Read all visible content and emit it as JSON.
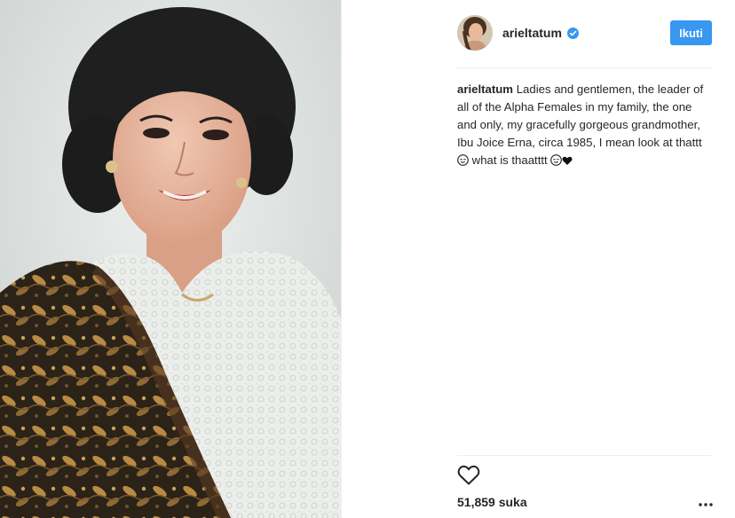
{
  "author": {
    "username": "arieltatum",
    "verified": true,
    "follow_label": "Ikuti"
  },
  "caption": {
    "username": "arieltatum",
    "text": "Ladies and gentlemen, the leader of all of the Alpha Females in my family, the one and only, my gracefully gorgeous grandmother, Ibu Joice Erna, circa 1985, I mean look at thattt",
    "text_after_emoji": "what is thaatttt",
    "emojis": [
      "relieved-face-emoji",
      "relieved-face-emoji",
      "black-heart-emoji"
    ]
  },
  "likes": {
    "count_label": "51,859 suka"
  },
  "icons": {
    "like": "heart-outline-icon",
    "more": "ellipsis-icon",
    "verified": "verified-badge-icon"
  },
  "colors": {
    "follow_button": "#3897f0",
    "verified_badge": "#3897f0",
    "text": "#262626",
    "divider": "#efefef"
  }
}
